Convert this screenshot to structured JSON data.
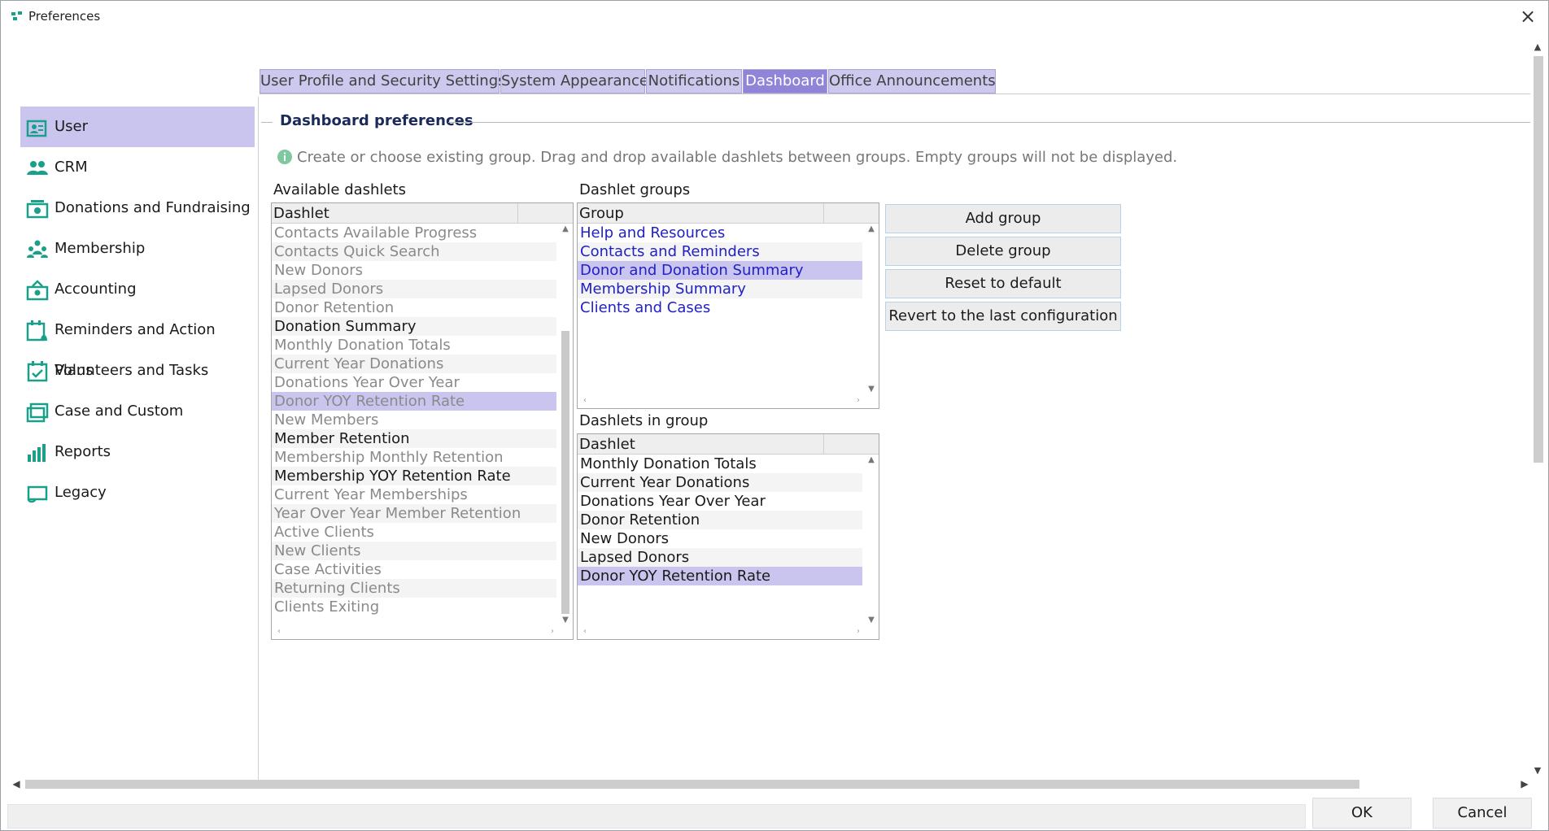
{
  "window": {
    "title": "Preferences"
  },
  "sidebar": {
    "items": [
      {
        "label": "User",
        "icon": "user-card-icon",
        "active": true
      },
      {
        "label": "CRM",
        "icon": "people-icon"
      },
      {
        "label": "Donations and Fundraising",
        "icon": "donation-icon"
      },
      {
        "label": "Membership",
        "icon": "membership-icon"
      },
      {
        "label": "Accounting",
        "icon": "accounting-icon"
      },
      {
        "label": "Reminders and Action Plans",
        "icon": "reminder-icon"
      },
      {
        "label": "Volunteers and Tasks",
        "icon": "calendar-check-icon"
      },
      {
        "label": "Case and Custom",
        "icon": "briefcase-icon"
      },
      {
        "label": "Reports",
        "icon": "bar-chart-icon"
      },
      {
        "label": "Legacy",
        "icon": "scroll-icon"
      }
    ]
  },
  "tabs": [
    {
      "label": "User Profile and Security Settings"
    },
    {
      "label": "System Appearance"
    },
    {
      "label": "Notifications"
    },
    {
      "label": "Dashboard",
      "active": true
    },
    {
      "label": "Office Announcements"
    }
  ],
  "dashboard": {
    "legend": "Dashboard preferences",
    "info": "Create or choose existing group. Drag and drop available dashlets between groups. Empty groups will not be displayed.",
    "available": {
      "label": "Available dashlets",
      "column": "Dashlet",
      "rows": [
        {
          "text": "Contacts Available Progress",
          "state": "dim"
        },
        {
          "text": "Contacts Quick Search",
          "state": "dim"
        },
        {
          "text": "New Donors",
          "state": "dim"
        },
        {
          "text": "Lapsed Donors",
          "state": "dim"
        },
        {
          "text": "Donor Retention",
          "state": "dim"
        },
        {
          "text": "Donation Summary",
          "state": "normal"
        },
        {
          "text": "Monthly Donation Totals",
          "state": "dim"
        },
        {
          "text": "Current Year Donations",
          "state": "dim"
        },
        {
          "text": "Donations Year Over Year",
          "state": "dim"
        },
        {
          "text": "Donor YOY Retention Rate",
          "state": "dim",
          "selected": true
        },
        {
          "text": "New Members",
          "state": "dim"
        },
        {
          "text": "Member Retention",
          "state": "normal"
        },
        {
          "text": "Membership Monthly Retention",
          "state": "dim"
        },
        {
          "text": "Membership YOY Retention Rate",
          "state": "normal"
        },
        {
          "text": "Current Year Memberships",
          "state": "dim"
        },
        {
          "text": "Year Over Year Member Retention",
          "state": "dim"
        },
        {
          "text": "Active Clients",
          "state": "dim"
        },
        {
          "text": "New Clients",
          "state": "dim"
        },
        {
          "text": "Case Activities",
          "state": "dim"
        },
        {
          "text": "Returning Clients",
          "state": "dim"
        },
        {
          "text": "Clients Exiting",
          "state": "dim"
        }
      ]
    },
    "groups": {
      "label": "Dashlet groups",
      "column": "Group",
      "rows": [
        {
          "text": "Help and Resources"
        },
        {
          "text": "Contacts and Reminders"
        },
        {
          "text": "Donor and Donation Summary",
          "selected": true
        },
        {
          "text": "Membership Summary"
        },
        {
          "text": "Clients and Cases"
        }
      ]
    },
    "in_group": {
      "label": "Dashlets in group",
      "column": "Dashlet",
      "rows": [
        {
          "text": "Monthly Donation Totals"
        },
        {
          "text": "Current Year Donations"
        },
        {
          "text": "Donations Year Over Year"
        },
        {
          "text": "Donor Retention"
        },
        {
          "text": "New Donors"
        },
        {
          "text": "Lapsed Donors"
        },
        {
          "text": "Donor YOY Retention Rate",
          "selected": true
        }
      ]
    },
    "buttons": {
      "add_group": "Add group",
      "delete_group": "Delete group",
      "reset_default": "Reset to default",
      "revert_last": "Revert to the last configuration"
    }
  },
  "footer": {
    "ok": "OK",
    "cancel": "Cancel"
  },
  "colors": {
    "accent": "#8f84d8",
    "tab_bg": "#cdc8ee",
    "selection": "#c9c5ef",
    "icon_teal": "#1aa08a",
    "link": "#2121c4"
  }
}
